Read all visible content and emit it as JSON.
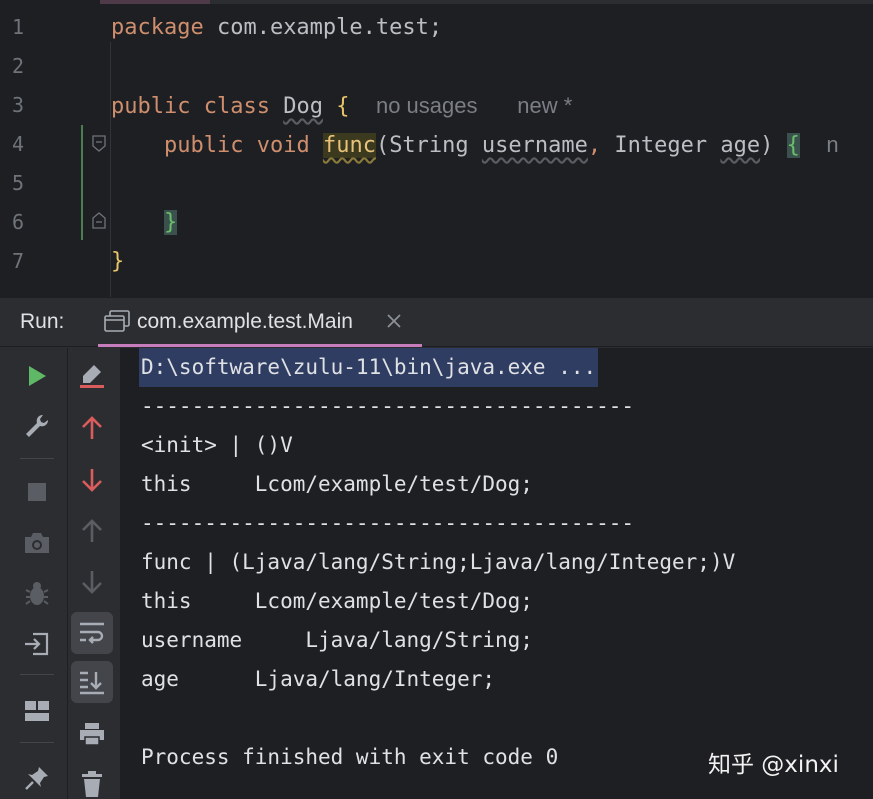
{
  "editor": {
    "line_numbers": [
      "1",
      "2",
      "3",
      "4",
      "5",
      "6",
      "7"
    ],
    "line1": {
      "kw": "package",
      "rest": " com.example.test;"
    },
    "line3": {
      "kw1": "public",
      "kw2": "class",
      "class_name": "Dog",
      "brace": "{",
      "hint1": "no usages",
      "hint2": "new *"
    },
    "line4": {
      "kw1": "public",
      "kw2": "void",
      "method": "func",
      "open": "(",
      "type1": "String",
      "param1": "username",
      "comma": ",",
      "type2": "Integer",
      "param2": "age",
      "close": ")",
      "brace": "{",
      "hint": "n"
    },
    "line6": {
      "brace": "}"
    },
    "line7": {
      "brace": "}"
    }
  },
  "run_panel": {
    "label": "Run:",
    "tab_label": "com.example.test.Main"
  },
  "console": {
    "lines": [
      "D:\\software\\zulu-11\\bin\\java.exe ...",
      "---------------------------------------",
      "<init> | ()V",
      "this     Lcom/example/test/Dog;",
      "---------------------------------------",
      "func | (Ljava/lang/String;Ljava/lang/Integer;)V",
      "this     Lcom/example/test/Dog;",
      "username     Ljava/lang/String;",
      "age      Ljava/lang/Integer;",
      "",
      "Process finished with exit code 0"
    ]
  },
  "toolbar_icons": {
    "left": [
      "run-icon",
      "wrench-icon",
      "stop-icon",
      "camera-icon",
      "bug-icon",
      "login-icon",
      "layout-icon",
      "pin-icon"
    ],
    "right": [
      "clear-icon",
      "arrow-up-red-icon",
      "arrow-down-red-icon",
      "arrow-up-icon",
      "arrow-down-icon",
      "soft-wrap-icon",
      "scroll-to-end-icon",
      "print-icon",
      "trash-icon"
    ]
  },
  "colors": {
    "keyword": "#cf8e6d",
    "run_green": "#5fb865",
    "arrow_red": "#db5c5c",
    "tab_accent": "#c77dbb",
    "selection": "#2f3d63"
  },
  "watermark": "知乎 @xinxi"
}
